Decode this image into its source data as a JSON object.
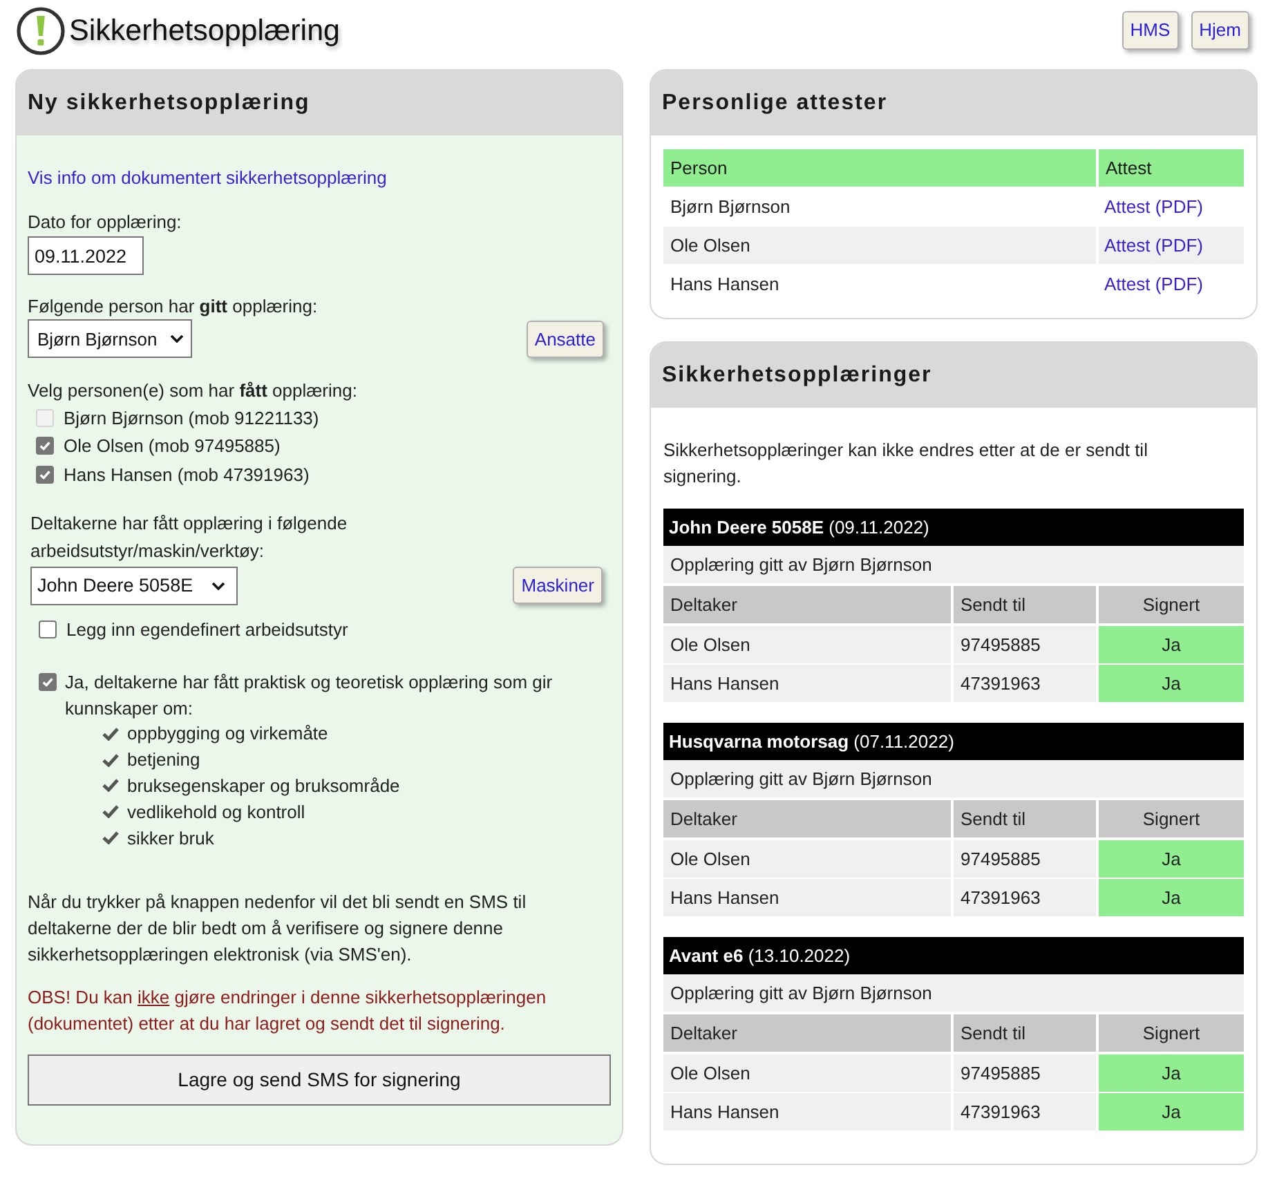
{
  "header": {
    "title": "Sikkerhetsopplæring",
    "nav_buttons": [
      "HMS",
      "Hjem"
    ]
  },
  "new_training": {
    "title": "Ny sikkerhetsopplæring",
    "info_link": "Vis info om dokumentert sikkerhetsopplæring",
    "date_label": "Dato for opplæring:",
    "date_value": "09.11.2022",
    "trainer_label": "Følgende person har **gitt** opplæring:",
    "trainer_value": "Bjørn Bjørnson",
    "trainer_button": "Ansatte",
    "trainees_label": "Velg personen(e) som har **fått** opplæring:",
    "trainees": [
      {
        "label": "Bjørn Bjørnson (mob 91221133)",
        "checked": false,
        "disabled": true
      },
      {
        "label": "Ole Olsen (mob 97495885)",
        "checked": true,
        "disabled": false
      },
      {
        "label": "Hans Hansen (mob 47391963)",
        "checked": true,
        "disabled": false
      }
    ],
    "equipment_label": "Deltakerne har fått opplæring i følgende arbeidsutstyr/maskin/verktøy:",
    "equipment_value": "John Deere 5058E",
    "equipment_button": "Maskiner",
    "custom_equipment": {
      "label": "Legg inn egendefinert arbeidsutstyr",
      "checked": false
    },
    "confirmation": {
      "label": "Ja, deltakerne har fått praktisk og teoretisk opplæring som gir kunnskaper om:",
      "checked": true
    },
    "topics": [
      "oppbygging og virkemåte",
      "betjening",
      "bruksegenskaper og bruksområde",
      "vedlikehold og kontroll",
      "sikker bruk"
    ],
    "sms_info": "Når du trykker på knappen nedenfor vil det bli sendt en SMS til deltakerne der de blir bedt om å verifisere og signere denne sikkerhetsopplæringen elektronisk (via SMS'en).",
    "warning": {
      "before": "OBS! Du kan",
      "underlined_word": "ikke",
      "after": "gjøre endringer i denne sikkerhetsopplæringen (dokumentet) etter at du har lagret og sendt det til signering."
    },
    "submit_button": "Lagre og send SMS for signering"
  },
  "certificates": {
    "title": "Personlige attester",
    "columns": [
      "Person",
      "Attest"
    ],
    "rows": [
      {
        "person": "Bjørn Bjørnson",
        "link": "Attest (PDF)"
      },
      {
        "person": "Ole Olsen",
        "link": "Attest (PDF)"
      },
      {
        "person": "Hans Hansen",
        "link": "Attest (PDF)"
      }
    ]
  },
  "trainings": {
    "title": "Sikkerhetsopplæringer",
    "note": "Sikkerhetsopplæringer kan ikke endres etter at de er sendt til signering.",
    "sessions": [
      {
        "title": "**John Deere 5058E** (09.11.2022)",
        "given_by": "Opplæring gitt av Bjørn Bjørnson",
        "columns": [
          "Deltaker",
          "Sendt til",
          "Signert"
        ],
        "rows": [
          {
            "participant": "Ole Olsen",
            "sent_to": "97495885",
            "signed": true,
            "signed_label": "Ja"
          },
          {
            "participant": "Hans Hansen",
            "sent_to": "47391963",
            "signed": true,
            "signed_label": "Ja"
          }
        ]
      },
      {
        "title": "**Husqvarna motorsag** (07.11.2022)",
        "given_by": "Opplæring gitt av Bjørn Bjørnson",
        "columns": [
          "Deltaker",
          "Sendt til",
          "Signert"
        ],
        "rows": [
          {
            "participant": "Ole Olsen",
            "sent_to": "97495885",
            "signed": true,
            "signed_label": "Ja"
          },
          {
            "participant": "Hans Hansen",
            "sent_to": "47391963",
            "signed": true,
            "signed_label": "Ja"
          }
        ]
      },
      {
        "title": "**Avant e6** (13.10.2022)",
        "given_by": "Opplæring gitt av Bjørn Bjørnson",
        "columns": [
          "Deltaker",
          "Sendt til",
          "Signert"
        ],
        "rows": [
          {
            "participant": "Ole Olsen",
            "sent_to": "97495885",
            "signed": true,
            "signed_label": "Ja"
          },
          {
            "participant": "Hans Hansen",
            "sent_to": "47391963",
            "signed": true,
            "signed_label": "Ja"
          }
        ]
      }
    ]
  }
}
